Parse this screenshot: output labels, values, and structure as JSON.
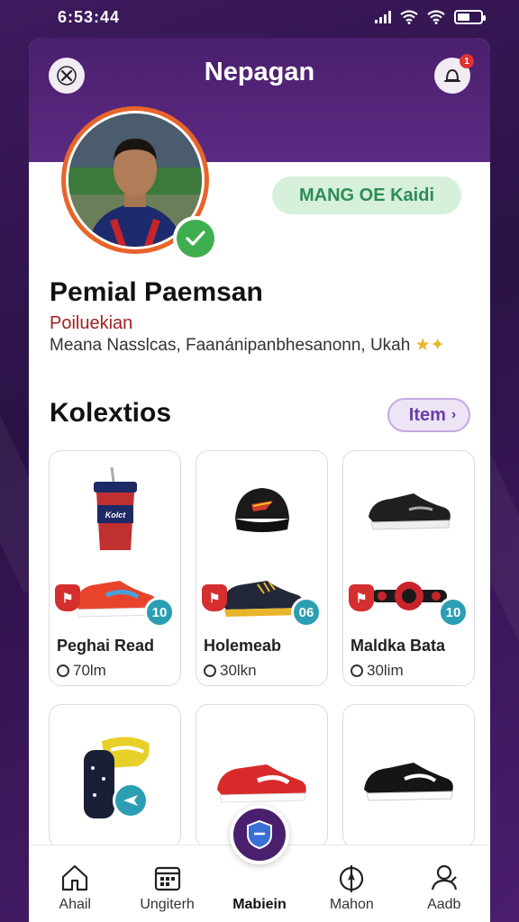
{
  "status_bar": {
    "time": "6:53:44"
  },
  "header": {
    "title": "Nepagan",
    "notification_count": "1"
  },
  "profile": {
    "badge": "MANG OE Kaidi",
    "name": "Pemial Paemsan",
    "role": "Poiluekian",
    "bio": "Meana Nasslcas, Faanánipanbhesanonn, Ukah",
    "verified": true
  },
  "collection": {
    "title": "Kolextios",
    "item_button": "Item",
    "items": [
      {
        "name": "Peghai Read",
        "meta": "70lm",
        "count": "10",
        "top": "cup-icon",
        "bottom": "sneaker-red-icon"
      },
      {
        "name": "Holemeab",
        "meta": "30lkn",
        "count": "06",
        "top": "cap-icon",
        "bottom": "sneaker-dark-icon"
      },
      {
        "name": "Maldka Bata",
        "meta": "30lim",
        "count": "10",
        "top": "sneaker-black-icon",
        "bottom": "band-icon"
      },
      {
        "name": "",
        "meta": "",
        "count": "",
        "top": "shin-guard-icon",
        "bottom": ""
      },
      {
        "name": "",
        "meta": "",
        "count": "",
        "top": "sneaker-red-white-icon",
        "bottom": ""
      },
      {
        "name": "",
        "meta": "",
        "count": "",
        "top": "sneaker-black-white-icon",
        "bottom": ""
      }
    ]
  },
  "nav": {
    "items": [
      {
        "label": "Ahail",
        "icon": "home-icon"
      },
      {
        "label": "Ungiterh",
        "icon": "calendar-icon"
      },
      {
        "label": "Mabiein",
        "icon": "shield-icon"
      },
      {
        "label": "Mahon",
        "icon": "compass-icon"
      },
      {
        "label": "Aadb",
        "icon": "profile-icon"
      }
    ]
  },
  "colors": {
    "brand": "#4a1f6e",
    "verified": "#3fae4f",
    "badge_green": "#d6f0dc",
    "count_teal": "#2b9eb3"
  }
}
